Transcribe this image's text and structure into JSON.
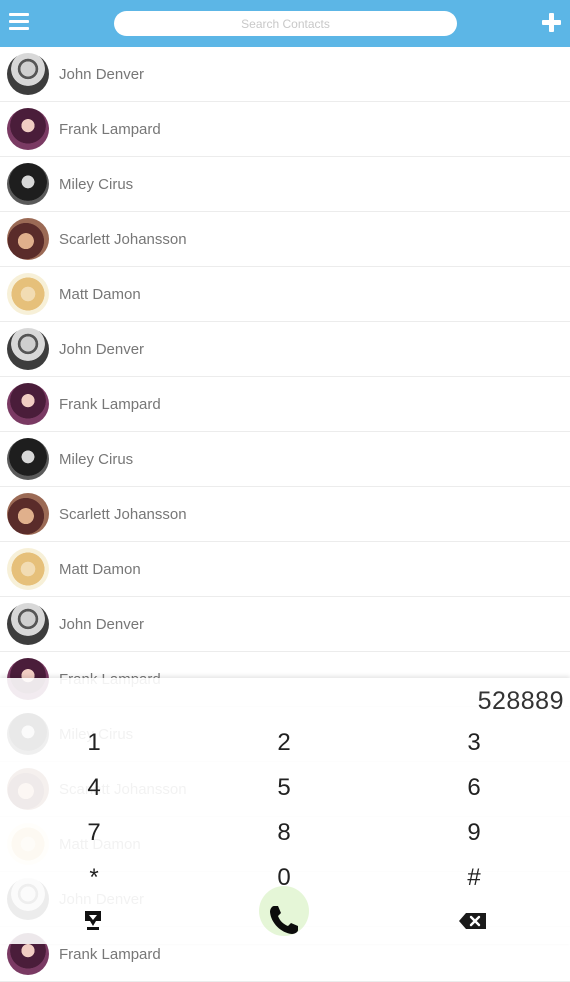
{
  "header": {
    "search_placeholder": "Search Contacts",
    "menu_icon": "hamburger-menu-icon",
    "add_icon": "plus-icon",
    "bar_color": "#5cb6e6"
  },
  "contacts": [
    {
      "name": "John Denver",
      "avatar": "john"
    },
    {
      "name": "Frank Lampard",
      "avatar": "frank"
    },
    {
      "name": "Miley Cirus",
      "avatar": "miley"
    },
    {
      "name": "Scarlett Johansson",
      "avatar": "scarlett"
    },
    {
      "name": "Matt Damon",
      "avatar": "matt"
    },
    {
      "name": "John Denver",
      "avatar": "john"
    },
    {
      "name": "Frank Lampard",
      "avatar": "frank"
    },
    {
      "name": "Miley Cirus",
      "avatar": "miley"
    },
    {
      "name": "Scarlett Johansson",
      "avatar": "scarlett"
    },
    {
      "name": "Matt Damon",
      "avatar": "matt"
    },
    {
      "name": "John Denver",
      "avatar": "john"
    },
    {
      "name": "Frank Lampard",
      "avatar": "frank"
    },
    {
      "name": "Miley Cirus",
      "avatar": "miley"
    },
    {
      "name": "Scarlett Johansson",
      "avatar": "scarlett"
    },
    {
      "name": "Matt Damon",
      "avatar": "matt"
    },
    {
      "name": "John Denver",
      "avatar": "john"
    },
    {
      "name": "Frank Lampard",
      "avatar": "frank"
    }
  ],
  "dialpad": {
    "number": "528889",
    "keys": [
      "1",
      "2",
      "3",
      "4",
      "5",
      "6",
      "7",
      "8",
      "9",
      "*",
      "0",
      "#"
    ],
    "left_icon": "contact-download-icon",
    "call_icon": "phone-call-icon",
    "right_icon": "backspace-icon"
  }
}
